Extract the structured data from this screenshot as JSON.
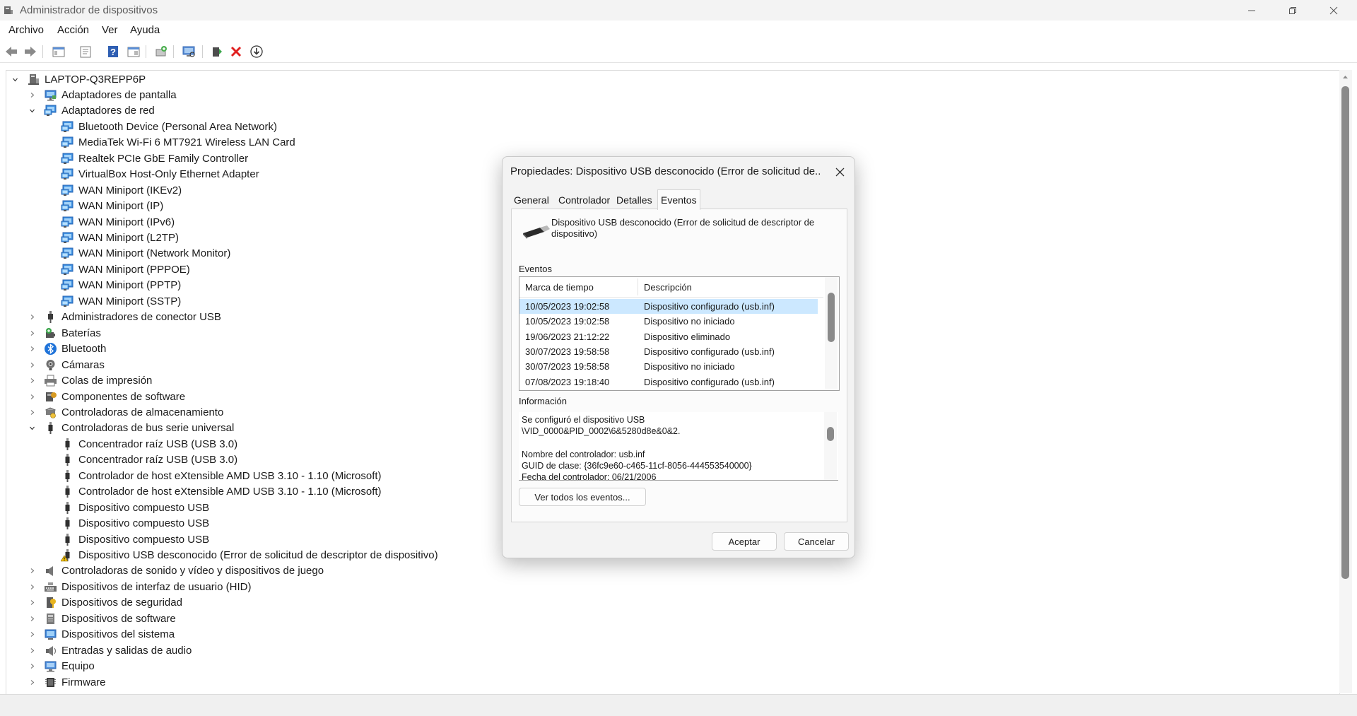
{
  "window": {
    "title": "Administrador de dispositivos"
  },
  "menu": [
    "Archivo",
    "Acción",
    "Ver",
    "Ayuda"
  ],
  "toolbar": {
    "icons": [
      "back-icon",
      "forward-icon",
      "show-hide-console-tree-icon",
      "properties-icon",
      "help-icon",
      "action-pane-icon",
      "update-driver-icon",
      "scan-hardware-icon",
      "add-driver-icon",
      "uninstall-icon",
      "download-icon"
    ]
  },
  "tree": {
    "root": "LAPTOP-Q3REPP6P",
    "items": [
      "Adaptadores de pantalla",
      "Adaptadores de red",
      "Bluetooth Device (Personal Area Network)",
      "MediaTek Wi-Fi 6 MT7921 Wireless LAN Card",
      "Realtek PCIe GbE Family Controller",
      "VirtualBox Host-Only Ethernet Adapter",
      "WAN Miniport (IKEv2)",
      "WAN Miniport (IP)",
      "WAN Miniport (IPv6)",
      "WAN Miniport (L2TP)",
      "WAN Miniport (Network Monitor)",
      "WAN Miniport (PPPOE)",
      "WAN Miniport (PPTP)",
      "WAN Miniport (SSTP)",
      "Administradores de conector USB",
      "Baterías",
      "Bluetooth",
      "Cámaras",
      "Colas de impresión",
      "Componentes de software",
      "Controladoras de almacenamiento",
      "Controladoras de bus serie universal",
      "Concentrador raíz USB (USB 3.0)",
      "Concentrador raíz USB (USB 3.0)",
      "Controlador de host eXtensible AMD USB 3.10 - 1.10 (Microsoft)",
      "Controlador de host eXtensible AMD USB 3.10 - 1.10 (Microsoft)",
      "Dispositivo compuesto USB",
      "Dispositivo compuesto USB",
      "Dispositivo compuesto USB",
      "Dispositivo USB desconocido (Error de solicitud de descriptor de dispositivo)",
      "Controladoras de sonido y vídeo y dispositivos de juego",
      "Dispositivos de interfaz de usuario (HID)",
      "Dispositivos de seguridad",
      "Dispositivos de software",
      "Dispositivos del sistema",
      "Entradas y salidas de audio",
      "Equipo",
      "Firmware"
    ]
  },
  "dialog": {
    "title": "Propiedades: Dispositivo USB desconocido (Error de solicitud de...",
    "tabs": [
      "General",
      "Controlador",
      "Detalles",
      "Eventos"
    ],
    "active_tab": "Eventos",
    "device_name": "Dispositivo USB desconocido (Error de solicitud de descriptor de dispositivo)",
    "events_label": "Eventos",
    "columns": [
      "Marca de tiempo",
      "Descripción"
    ],
    "events": [
      {
        "time": "10/05/2023 19:02:58",
        "desc": "Dispositivo configurado (usb.inf)"
      },
      {
        "time": "10/05/2023 19:02:58",
        "desc": "Dispositivo no iniciado"
      },
      {
        "time": "19/06/2023 21:12:22",
        "desc": "Dispositivo eliminado"
      },
      {
        "time": "30/07/2023 19:58:58",
        "desc": "Dispositivo configurado (usb.inf)"
      },
      {
        "time": "30/07/2023 19:58:58",
        "desc": "Dispositivo no iniciado"
      },
      {
        "time": "07/08/2023 19:18:40",
        "desc": "Dispositivo configurado (usb.inf)"
      }
    ],
    "info_label": "Información",
    "info_lines": [
      "Se configuró el dispositivo USB",
      "\\VID_0000&PID_0002\\6&5280d8e&0&2.",
      "",
      "Nombre del controlador: usb.inf",
      "GUID de clase: {36fc9e60-c465-11cf-8056-444553540000}",
      "Fecha del controlador: 06/21/2006"
    ],
    "view_all_button": "Ver todos los eventos...",
    "ok_button": "Aceptar",
    "cancel_button": "Cancelar"
  }
}
